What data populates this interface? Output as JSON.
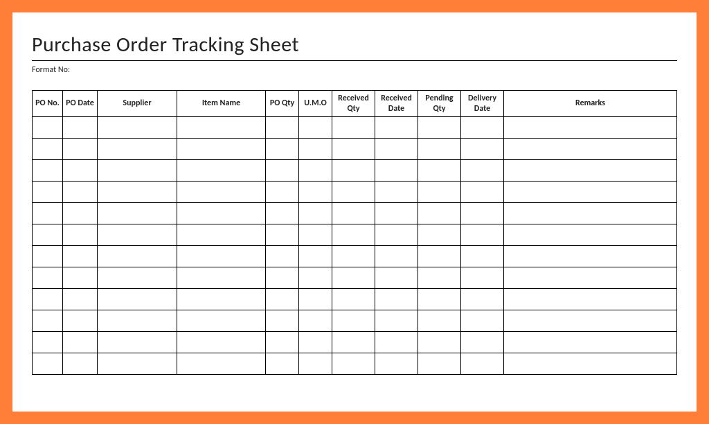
{
  "title": "Purchase Order Tracking Sheet",
  "format_label": "Format No:",
  "format_value": "",
  "table": {
    "headers": {
      "po_no": "PO No.",
      "po_date": "PO Date",
      "supplier": "Supplier",
      "item_name": "Item Name",
      "po_qty": "PO Qty",
      "umo": "U.M.O",
      "received_qty": "Received Qty",
      "received_date": "Received Date",
      "pending_qty": "Pending Qty",
      "delivery_date": "Delivery Date",
      "remarks": "Remarks"
    },
    "rows": [
      {
        "po_no": "",
        "po_date": "",
        "supplier": "",
        "item_name": "",
        "po_qty": "",
        "umo": "",
        "received_qty": "",
        "received_date": "",
        "pending_qty": "",
        "delivery_date": "",
        "remarks": ""
      },
      {
        "po_no": "",
        "po_date": "",
        "supplier": "",
        "item_name": "",
        "po_qty": "",
        "umo": "",
        "received_qty": "",
        "received_date": "",
        "pending_qty": "",
        "delivery_date": "",
        "remarks": ""
      },
      {
        "po_no": "",
        "po_date": "",
        "supplier": "",
        "item_name": "",
        "po_qty": "",
        "umo": "",
        "received_qty": "",
        "received_date": "",
        "pending_qty": "",
        "delivery_date": "",
        "remarks": ""
      },
      {
        "po_no": "",
        "po_date": "",
        "supplier": "",
        "item_name": "",
        "po_qty": "",
        "umo": "",
        "received_qty": "",
        "received_date": "",
        "pending_qty": "",
        "delivery_date": "",
        "remarks": ""
      },
      {
        "po_no": "",
        "po_date": "",
        "supplier": "",
        "item_name": "",
        "po_qty": "",
        "umo": "",
        "received_qty": "",
        "received_date": "",
        "pending_qty": "",
        "delivery_date": "",
        "remarks": ""
      },
      {
        "po_no": "",
        "po_date": "",
        "supplier": "",
        "item_name": "",
        "po_qty": "",
        "umo": "",
        "received_qty": "",
        "received_date": "",
        "pending_qty": "",
        "delivery_date": "",
        "remarks": ""
      },
      {
        "po_no": "",
        "po_date": "",
        "supplier": "",
        "item_name": "",
        "po_qty": "",
        "umo": "",
        "received_qty": "",
        "received_date": "",
        "pending_qty": "",
        "delivery_date": "",
        "remarks": ""
      },
      {
        "po_no": "",
        "po_date": "",
        "supplier": "",
        "item_name": "",
        "po_qty": "",
        "umo": "",
        "received_qty": "",
        "received_date": "",
        "pending_qty": "",
        "delivery_date": "",
        "remarks": ""
      },
      {
        "po_no": "",
        "po_date": "",
        "supplier": "",
        "item_name": "",
        "po_qty": "",
        "umo": "",
        "received_qty": "",
        "received_date": "",
        "pending_qty": "",
        "delivery_date": "",
        "remarks": ""
      },
      {
        "po_no": "",
        "po_date": "",
        "supplier": "",
        "item_name": "",
        "po_qty": "",
        "umo": "",
        "received_qty": "",
        "received_date": "",
        "pending_qty": "",
        "delivery_date": "",
        "remarks": ""
      },
      {
        "po_no": "",
        "po_date": "",
        "supplier": "",
        "item_name": "",
        "po_qty": "",
        "umo": "",
        "received_qty": "",
        "received_date": "",
        "pending_qty": "",
        "delivery_date": "",
        "remarks": ""
      },
      {
        "po_no": "",
        "po_date": "",
        "supplier": "",
        "item_name": "",
        "po_qty": "",
        "umo": "",
        "received_qty": "",
        "received_date": "",
        "pending_qty": "",
        "delivery_date": "",
        "remarks": ""
      }
    ]
  }
}
